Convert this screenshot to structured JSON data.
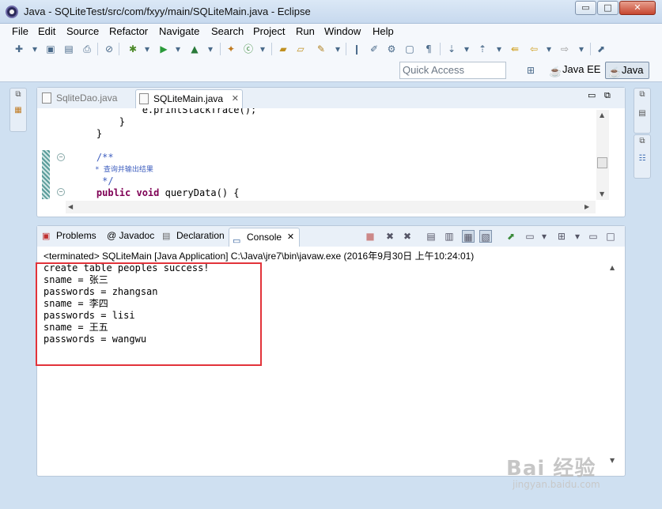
{
  "window": {
    "title": "Java - SQLiteTest/src/com/fxyy/main/SQLiteMain.java - Eclipse",
    "min_label": "▭",
    "max_label": "□",
    "close_label": "✕"
  },
  "menu": [
    "File",
    "Edit",
    "Source",
    "Refactor",
    "Navigate",
    "Search",
    "Project",
    "Run",
    "Window",
    "Help"
  ],
  "toolbar": {
    "quick_access": "Quick Access",
    "perspectives": [
      "Java EE",
      "Java"
    ]
  },
  "editor": {
    "tabs": [
      {
        "label": "SqliteDao.java",
        "active": false
      },
      {
        "label": "SQLiteMain.java",
        "active": true,
        "close": "✕"
      }
    ],
    "lines": [
      {
        "text": "            e.printStackTrace();",
        "kind": "plain"
      },
      {
        "text": "        }",
        "kind": "plain"
      },
      {
        "text": "    }",
        "kind": "plain"
      },
      {
        "text": "",
        "kind": "plain"
      },
      {
        "text": "    /**",
        "kind": "comment"
      },
      {
        "text": "     * 查询并输出结果",
        "kind": "comment"
      },
      {
        "text": "     */",
        "kind": "comment"
      },
      {
        "text": "    public void queryData() {",
        "kind": "code"
      }
    ]
  },
  "console": {
    "tabs": [
      "Problems",
      "@ Javadoc",
      "Declaration",
      "Console"
    ],
    "terminated": "<terminated> SQLiteMain [Java Application] C:\\Java\\jre7\\bin\\javaw.exe (2016年9月30日 上午10:24:01)",
    "output": [
      "create table peoples success!",
      "sname = 张三",
      "passwords = zhangsan",
      "sname = 李四",
      "passwords = lisi",
      "sname = 王五",
      "passwords = wangwu"
    ]
  },
  "watermark": {
    "main": "Bai 经验",
    "sub": "jingyan.baidu.com"
  },
  "colors": {
    "highlight": "#e2333a",
    "keyword": "#7f0055",
    "comment": "#3f5fbf"
  }
}
